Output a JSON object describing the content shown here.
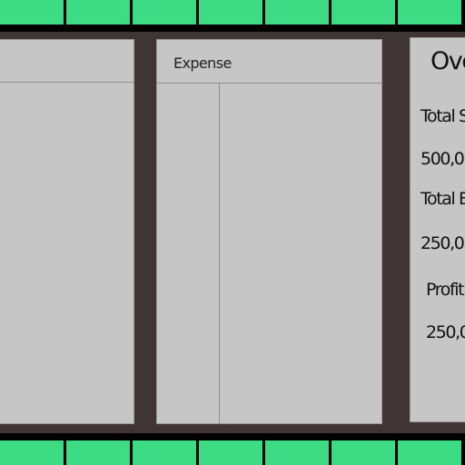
{
  "expense_panel": {
    "header": "Expense"
  },
  "overview_panel": {
    "title": "Ove",
    "total_sales_label": "Total S",
    "total_sales_value": "500,0",
    "total_expense_label": "Total E",
    "total_expense_value": "250,0",
    "profit_label": "Profit",
    "profit_value": "250,0"
  },
  "colors": {
    "accent_tiles": "#3ddc84",
    "background": "#3f3536",
    "panel": "#c6c6c6",
    "frame": "#000000"
  }
}
